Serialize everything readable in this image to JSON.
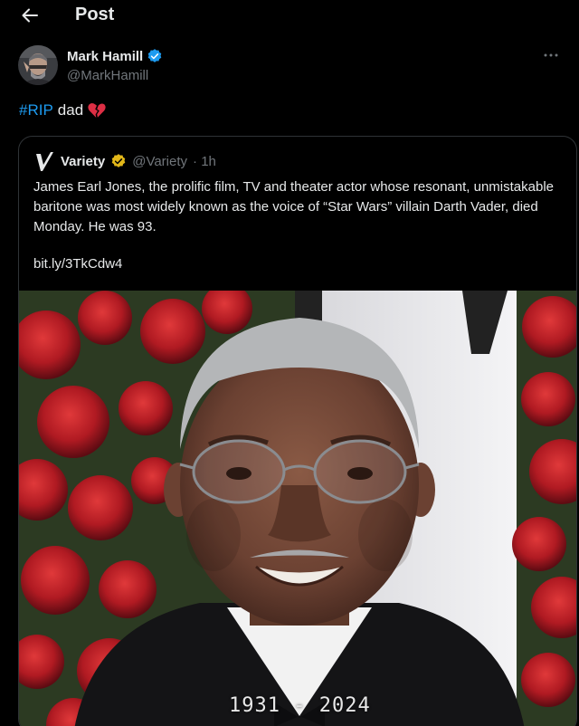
{
  "header": {
    "title": "Post",
    "back_icon": "arrow-left-icon"
  },
  "post": {
    "author_name": "Mark Hamill",
    "author_handle": "@MarkHamill",
    "verified_color": "#1d9bf0",
    "hashtag": "#RIP",
    "text": "dad",
    "emoji": "broken-heart-icon"
  },
  "quote": {
    "name": "Variety",
    "handle": "@Variety",
    "time": "· 1h",
    "verified_color": "#e2b719",
    "body": "James Earl Jones, the prolific film, TV and theater actor whose resonant, unmistakable baritone was most widely known as the voice of “Star Wars” villain Darth Vader, died Monday. He was 93.",
    "link": "bit.ly/3TkCdw4",
    "media_caption": "1931 - 2024"
  },
  "colors": {
    "background": "#000000",
    "accent": "#1d9bf0",
    "secondary_text": "#71767b",
    "border": "#2f3336"
  }
}
